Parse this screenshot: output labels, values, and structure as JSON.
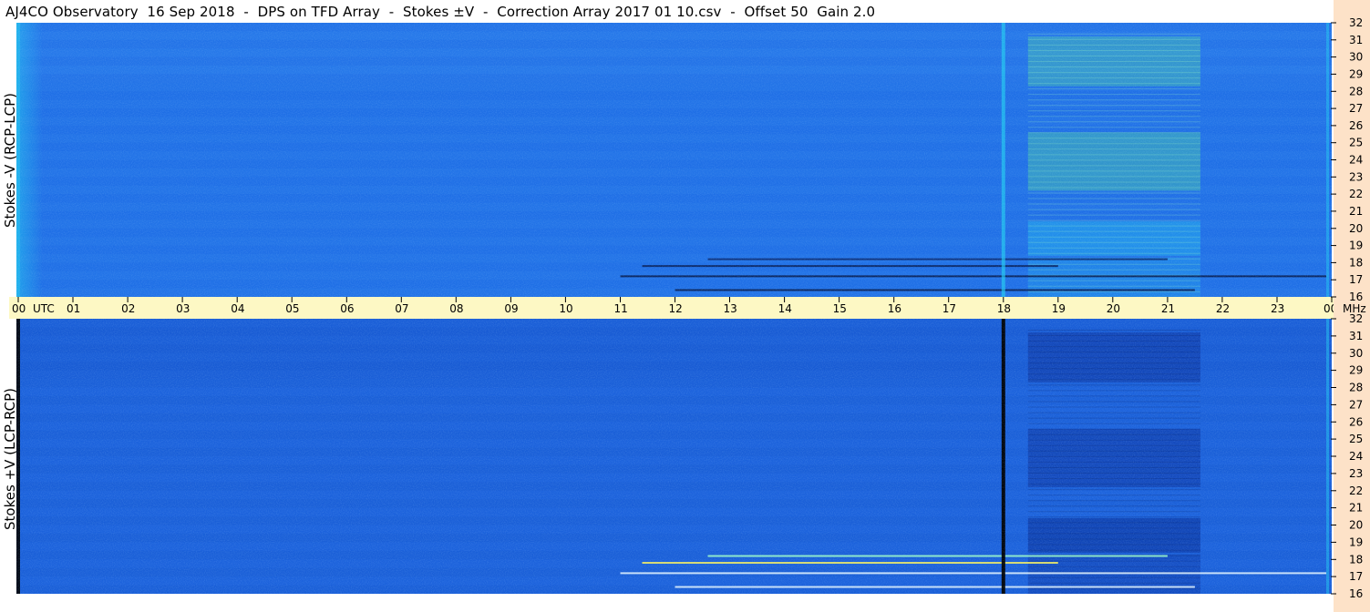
{
  "title": "AJ4CO Observatory  16 Sep 2018  -  DPS on TFD Array  -  Stokes ±V  -  Correction Array 2017 01 10.csv  -  Offset 50  Gain 2.0",
  "colors": {
    "background_blue": "#1f6fe6",
    "dark_blue": "#0a2f9a",
    "cyan": "#22c8f0",
    "green": "#5cf090",
    "yellow": "#f8f060",
    "axis_band": "#fdf8c4",
    "freq_band": "#fde2c8"
  },
  "chart_data": [
    {
      "type": "heatmap",
      "name": "top-panel",
      "ylabel": "Stokes -V (RCP-LCP)",
      "y_unit": "",
      "yticks": [
        "32",
        "31",
        "30",
        "29",
        "28",
        "27",
        "26",
        "25",
        "24",
        "23",
        "22",
        "21",
        "20",
        "19",
        "18",
        "17",
        "16"
      ],
      "ylim": [
        16,
        32
      ],
      "xlim": [
        0,
        24
      ]
    },
    {
      "type": "heatmap",
      "name": "bottom-panel",
      "ylabel": "Stokes +V (LCP-RCP)",
      "y_unit": "MHz",
      "yticks": [
        "32",
        "31",
        "30",
        "29",
        "28",
        "27",
        "26",
        "25",
        "24",
        "23",
        "22",
        "21",
        "20",
        "19",
        "18",
        "17",
        "16"
      ],
      "ylim": [
        16,
        32
      ],
      "xlim": [
        0,
        24
      ]
    }
  ],
  "time_axis": {
    "first_label": "00",
    "unit_label": "UTC",
    "labels": [
      "01",
      "02",
      "03",
      "04",
      "05",
      "06",
      "07",
      "08",
      "09",
      "10",
      "11",
      "12",
      "13",
      "14",
      "15",
      "16",
      "17",
      "18",
      "19",
      "20",
      "21",
      "22",
      "23"
    ],
    "last_label": "00"
  }
}
